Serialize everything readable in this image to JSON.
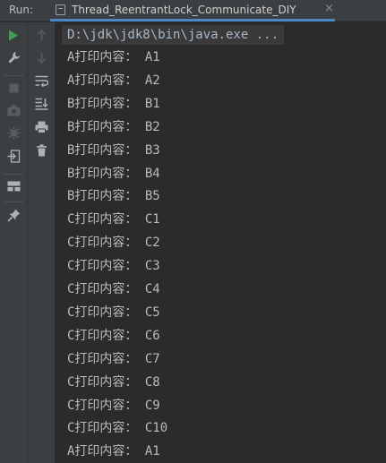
{
  "header": {
    "run_label": "Run:",
    "tab_title": "Thread_ReentrantLock_Communicate_DIY",
    "close_glyph": "×"
  },
  "toolbar": {
    "left": [
      "run-icon",
      "wrench-icon",
      "stop-icon",
      "camera-icon",
      "debug-icon",
      "exit-icon",
      "layout-icon",
      "pin-icon"
    ],
    "right": [
      "up-arrow-icon",
      "down-arrow-icon",
      "soft-wrap-icon",
      "scroll-to-end-icon",
      "print-icon",
      "trash-icon"
    ]
  },
  "console": {
    "command": "D:\\jdk\\jdk8\\bin\\java.exe ...",
    "lines": [
      "A打印内容： A1",
      "A打印内容： A2",
      "B打印内容： B1",
      "B打印内容： B2",
      "B打印内容： B3",
      "B打印内容： B4",
      "B打印内容： B5",
      "C打印内容： C1",
      "C打印内容： C2",
      "C打印内容： C3",
      "C打印内容： C4",
      "C打印内容： C5",
      "C打印内容： C6",
      "C打印内容： C7",
      "C打印内容： C8",
      "C打印内容： C9",
      "C打印内容： C10",
      "A打印内容： A1"
    ]
  },
  "colors": {
    "background": "#2b2b2b",
    "panel": "#3c3f41",
    "run_green": "#499c54",
    "tab_accent": "#4a88c7"
  }
}
